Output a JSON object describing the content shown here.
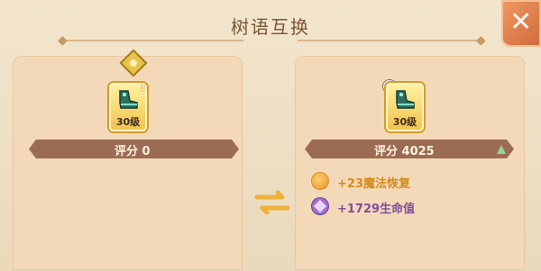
{
  "header": {
    "title": "树语互换",
    "close_icon": "close-icon"
  },
  "left_panel": {
    "item_level": "30级",
    "item_badge": "3",
    "score_label": "评分",
    "score_value": "0"
  },
  "right_panel": {
    "item_level": "30级",
    "score_label": "评分",
    "score_value": "4025",
    "stats": [
      {
        "text": "+23魔法恢复",
        "icon": "mana-icon"
      },
      {
        "text": "+1729生命值",
        "icon": "hp-icon"
      }
    ]
  },
  "colors": {
    "title": "#7a5536",
    "score_bar": "#9b6c53",
    "stat_mana": "#d48b1b",
    "stat_hp": "#7f4f9d",
    "accent_close": "#d06a3d",
    "swap": "#f0b13b"
  },
  "icons": {
    "swap": "swap-arrows-icon",
    "lock": "lock-icon",
    "up": "up-arrow-icon",
    "marker": "diamond-marker-icon",
    "item": "boot-icon"
  }
}
